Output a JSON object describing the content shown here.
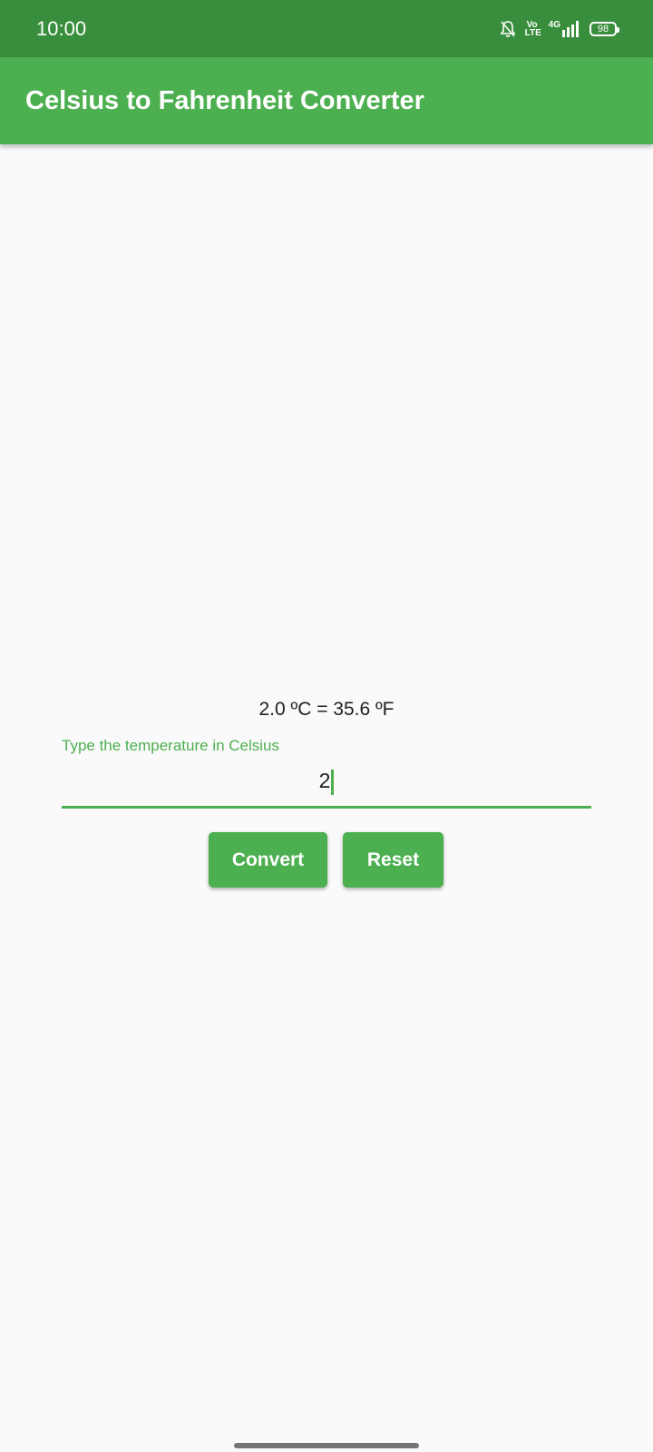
{
  "status_bar": {
    "time": "10:00",
    "icons": [
      "bell-off-icon",
      "volte-icon",
      "4g-signal-icon",
      "battery-icon"
    ],
    "volte_top": "Vo",
    "volte_bottom": "LTE",
    "network": "4G",
    "battery_level": "98"
  },
  "app_bar": {
    "title": "Celsius to Fahrenheit Converter",
    "color": "#4caf50"
  },
  "main": {
    "result": "2.0 ºC = 35.6 ºF",
    "input": {
      "label": "Type the temperature in Celsius",
      "value": "2"
    },
    "buttons": {
      "convert_label": "Convert",
      "reset_label": "Reset"
    }
  },
  "colors": {
    "status_bar": "#388e3c",
    "accent": "#4caf50",
    "background": "#fafafa"
  }
}
